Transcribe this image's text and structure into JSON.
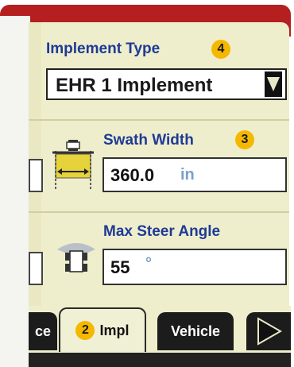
{
  "implement_type": {
    "label": "Implement Type",
    "badge": "4",
    "selected": "EHR 1 Implement"
  },
  "swath_width": {
    "label": "Swath Width",
    "badge": "3",
    "value": "360.0",
    "unit": "in"
  },
  "max_steer_angle": {
    "label": "Max Steer Angle",
    "value": "55",
    "unit": "°"
  },
  "tabs": {
    "partial_label": "ce",
    "impl_badge": "2",
    "impl_label": "Impl",
    "vehicle_label": "Vehicle"
  },
  "colors": {
    "frame": "#b51f1f",
    "screen": "#eeeecc",
    "label": "#1f3a96",
    "badge": "#f5b800"
  }
}
